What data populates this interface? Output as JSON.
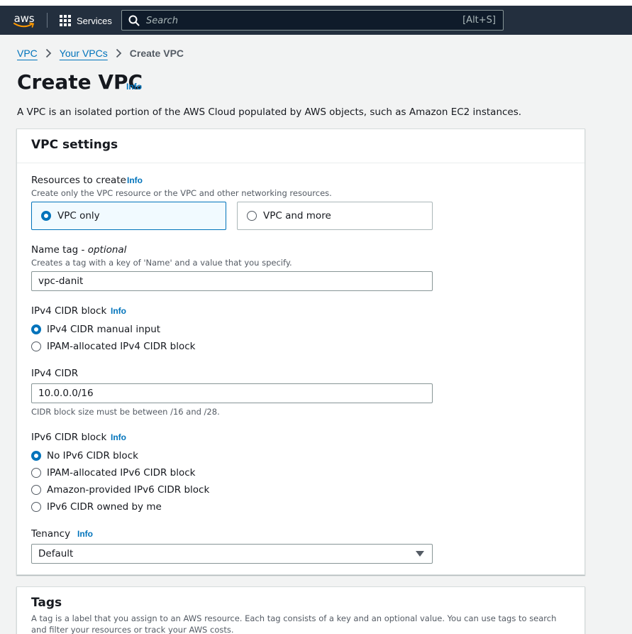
{
  "nav": {
    "logo_text": "aws",
    "services_label": "Services",
    "search_placeholder": "Search",
    "search_shortcut": "[Alt+S]"
  },
  "breadcrumb": {
    "items": [
      "VPC",
      "Your VPCs"
    ],
    "current": "Create VPC"
  },
  "page": {
    "title": "Create VPC",
    "info_label": "Info",
    "description": "A VPC is an isolated portion of the AWS Cloud populated by AWS objects, such as Amazon EC2 instances."
  },
  "vpc_settings": {
    "title": "VPC settings",
    "resources": {
      "label": "Resources to create",
      "info": "Info",
      "description": "Create only the VPC resource or the VPC and other networking resources.",
      "options": [
        "VPC only",
        "VPC and more"
      ],
      "selected": "VPC only"
    },
    "name_tag": {
      "label": "Name tag - ",
      "label_optional": "optional",
      "description": "Creates a tag with a key of 'Name' and a value that you specify.",
      "value": "vpc-danit"
    },
    "ipv4_block": {
      "label": "IPv4 CIDR block",
      "info": "Info",
      "options": [
        "IPv4 CIDR manual input",
        "IPAM-allocated IPv4 CIDR block"
      ],
      "selected": "IPv4 CIDR manual input"
    },
    "ipv4_cidr": {
      "label": "IPv4 CIDR",
      "value": "10.0.0.0/16",
      "hint": "CIDR block size must be between /16 and /28."
    },
    "ipv6_block": {
      "label": "IPv6 CIDR block",
      "info": "Info",
      "options": [
        "No IPv6 CIDR block",
        "IPAM-allocated IPv6 CIDR block",
        "Amazon-provided IPv6 CIDR block",
        "IPv6 CIDR owned by me"
      ],
      "selected": "No IPv6 CIDR block"
    },
    "tenancy": {
      "label": "Tenancy",
      "info": "Info",
      "value": "Default"
    }
  },
  "tags": {
    "title": "Tags",
    "description": "A tag is a label that you assign to an AWS resource. Each tag consists of a key and an optional value. You can use tags to search and filter your resources or track your AWS costs."
  },
  "colors": {
    "nav_bg": "#232f3e",
    "link": "#0073bb",
    "selected_tile_bg": "#f1faff",
    "page_bg": "#f2f3f3",
    "logo_smile": "#ff9900"
  }
}
